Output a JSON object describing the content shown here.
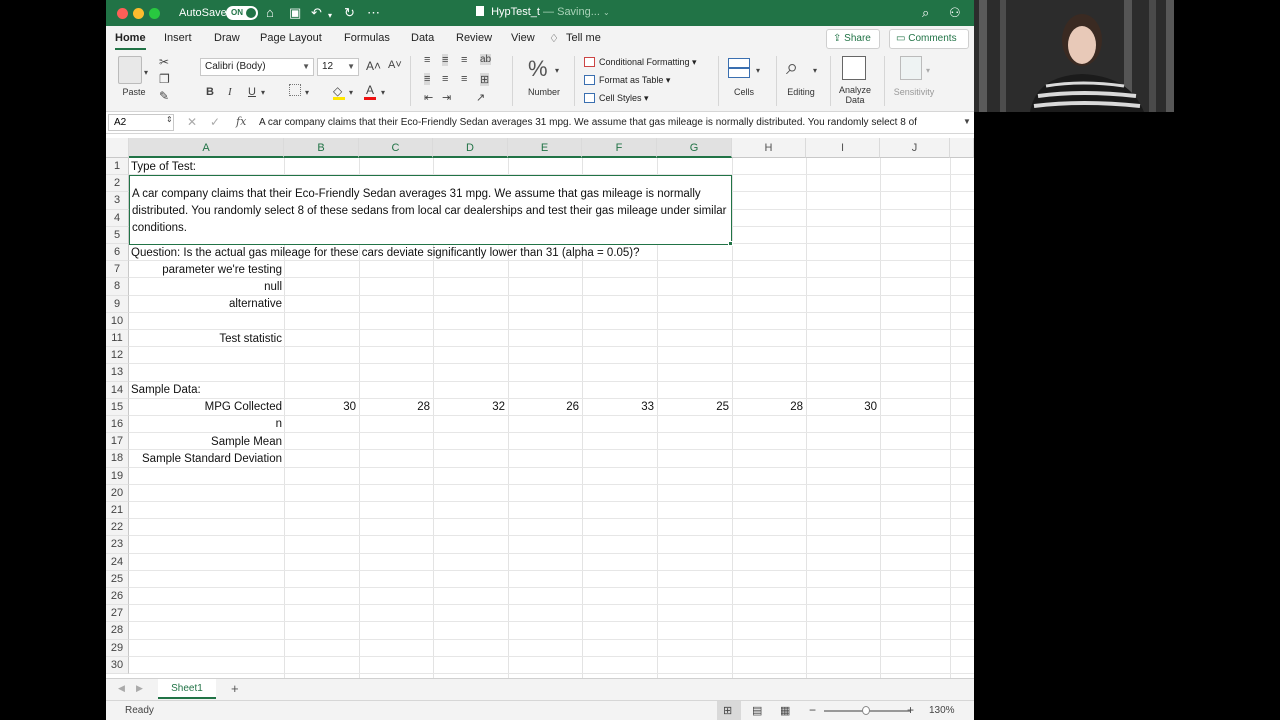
{
  "titlebar": {
    "autosave_label": "AutoSave",
    "autosave_state": "ON",
    "file_name": "HypTest_t",
    "status": "— Saving..."
  },
  "tabs": [
    "Home",
    "Insert",
    "Draw",
    "Page Layout",
    "Formulas",
    "Data",
    "Review",
    "View"
  ],
  "tell_me": "Tell me",
  "share_label": "Share",
  "comments_label": "Comments",
  "ribbon": {
    "paste_label": "Paste",
    "font_name": "Calibri (Body)",
    "font_size": "12",
    "bold": "B",
    "italic": "I",
    "underline": "U",
    "number_label": "Number",
    "number_glyph": "%",
    "conditional_formatting": "Conditional Formatting",
    "format_as_table": "Format as Table",
    "cell_styles": "Cell Styles",
    "cells_label": "Cells",
    "editing_label": "Editing",
    "analyze_label_1": "Analyze",
    "analyze_label_2": "Data",
    "sensitivity_label": "Sensitivity"
  },
  "formula_bar": {
    "name_box": "A2",
    "fx": "fx",
    "content": "A car company claims that their Eco-Friendly Sedan averages 31 mpg. We assume that gas mileage is normally distributed. You randomly select 8 of"
  },
  "columns": [
    "A",
    "B",
    "C",
    "D",
    "E",
    "F",
    "G",
    "H",
    "I",
    "J"
  ],
  "rows": [
    "1",
    "2",
    "3",
    "4",
    "5",
    "6",
    "7",
    "8",
    "9",
    "10",
    "11",
    "12",
    "13",
    "14",
    "15",
    "16",
    "17",
    "18",
    "19",
    "20",
    "21",
    "22",
    "23",
    "24",
    "25",
    "26",
    "27",
    "28",
    "29",
    "30"
  ],
  "cells": {
    "a1": "Type of Test:",
    "a2_merged": "A car company claims that their Eco-Friendly Sedan averages 31 mpg. We assume that gas mileage is normally distributed. You randomly select 8 of these sedans from local car dealerships and test their gas mileage under similar conditions.",
    "a6": "Question: Is the actual gas mileage for these cars deviate significantly lower than 31 (alpha = 0.05)?",
    "a7": "parameter we're testing",
    "a8": "null",
    "a9": "alternative",
    "a11": "Test statistic",
    "a14": "Sample Data:",
    "a15": "MPG Collected",
    "mpg_values": [
      "30",
      "28",
      "32",
      "26",
      "33",
      "25",
      "28",
      "30"
    ],
    "a16": "n",
    "a17": "Sample Mean",
    "a18": "Sample Standard Deviation"
  },
  "sheet_tab": "Sheet1",
  "add_sheet": "+",
  "status": {
    "ready": "Ready",
    "zoom": "130%",
    "zoom_minus": "−",
    "zoom_plus": "+"
  },
  "colors": {
    "excel_green": "#217346",
    "ribbon_bg": "#f3f3f3"
  }
}
